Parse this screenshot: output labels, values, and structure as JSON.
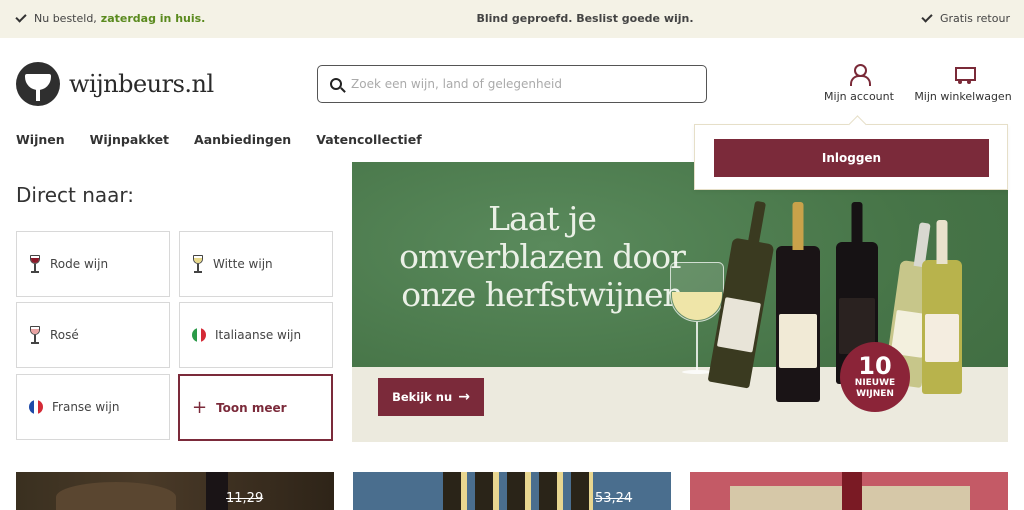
{
  "topbar": {
    "left_prefix": "Nu besteld,",
    "left_highlight": "zaterdag in huis.",
    "center": "Blind geproefd. Beslist goede wijn.",
    "right": "Gratis retour"
  },
  "header": {
    "logo_text": "wijnbeurs.nl",
    "search_placeholder": "Zoek een wijn, land of gelegenheid",
    "account_label": "Mijn account",
    "cart_label": "Mijn winkelwagen"
  },
  "nav": {
    "items": [
      "Wijnen",
      "Wijnpakket",
      "Aanbiedingen",
      "Vatencollectief"
    ]
  },
  "account_dropdown": {
    "login_label": "Inloggen"
  },
  "direct": {
    "title": "Direct naar:",
    "tiles": [
      {
        "label": "Rode wijn",
        "icon": "red-wine-glass-icon"
      },
      {
        "label": "Witte wijn",
        "icon": "white-wine-glass-icon"
      },
      {
        "label": "Rosé",
        "icon": "rose-wine-glass-icon"
      },
      {
        "label": "Italiaanse wijn",
        "icon": "italy-flag-icon"
      },
      {
        "label": "Franse wijn",
        "icon": "france-flag-icon"
      },
      {
        "label": "Toon meer",
        "icon": "plus-icon"
      }
    ]
  },
  "hero": {
    "headline_1": "Laat je",
    "headline_2": "omverblazen door",
    "headline_3": "onze herfstwijnen",
    "cta_label": "Bekijk nu",
    "badge_number": "10",
    "badge_line1": "NIEUWE",
    "badge_line2": "WIJNEN"
  },
  "cards": {
    "card1_old_price": "11,29",
    "card2_old_price": "53,24"
  },
  "colors": {
    "brand": "#7b2a3a",
    "topbar_bg": "#f4f2e6",
    "highlight_green": "#5a8a1e"
  }
}
